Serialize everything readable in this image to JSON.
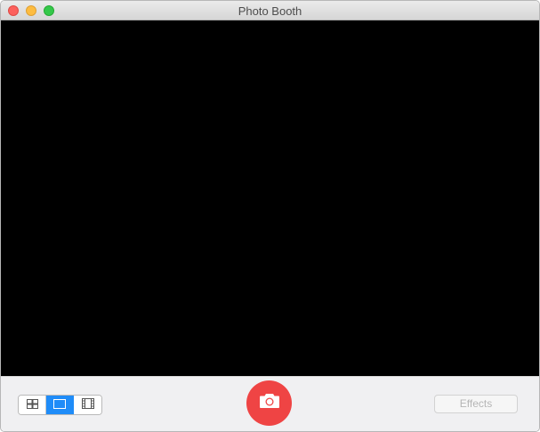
{
  "window": {
    "title": "Photo Booth"
  },
  "toolbar": {
    "view_modes": [
      {
        "name": "four-up-grid-icon",
        "selected": false
      },
      {
        "name": "single-photo-icon",
        "selected": true
      },
      {
        "name": "video-filmstrip-icon",
        "selected": false
      }
    ],
    "shutter_icon": "camera-icon",
    "effects_label": "Effects",
    "effects_enabled": false
  },
  "colors": {
    "shutter": "#ef4444",
    "selected_segment": "#1f8cf8",
    "preview_background": "#000000"
  }
}
